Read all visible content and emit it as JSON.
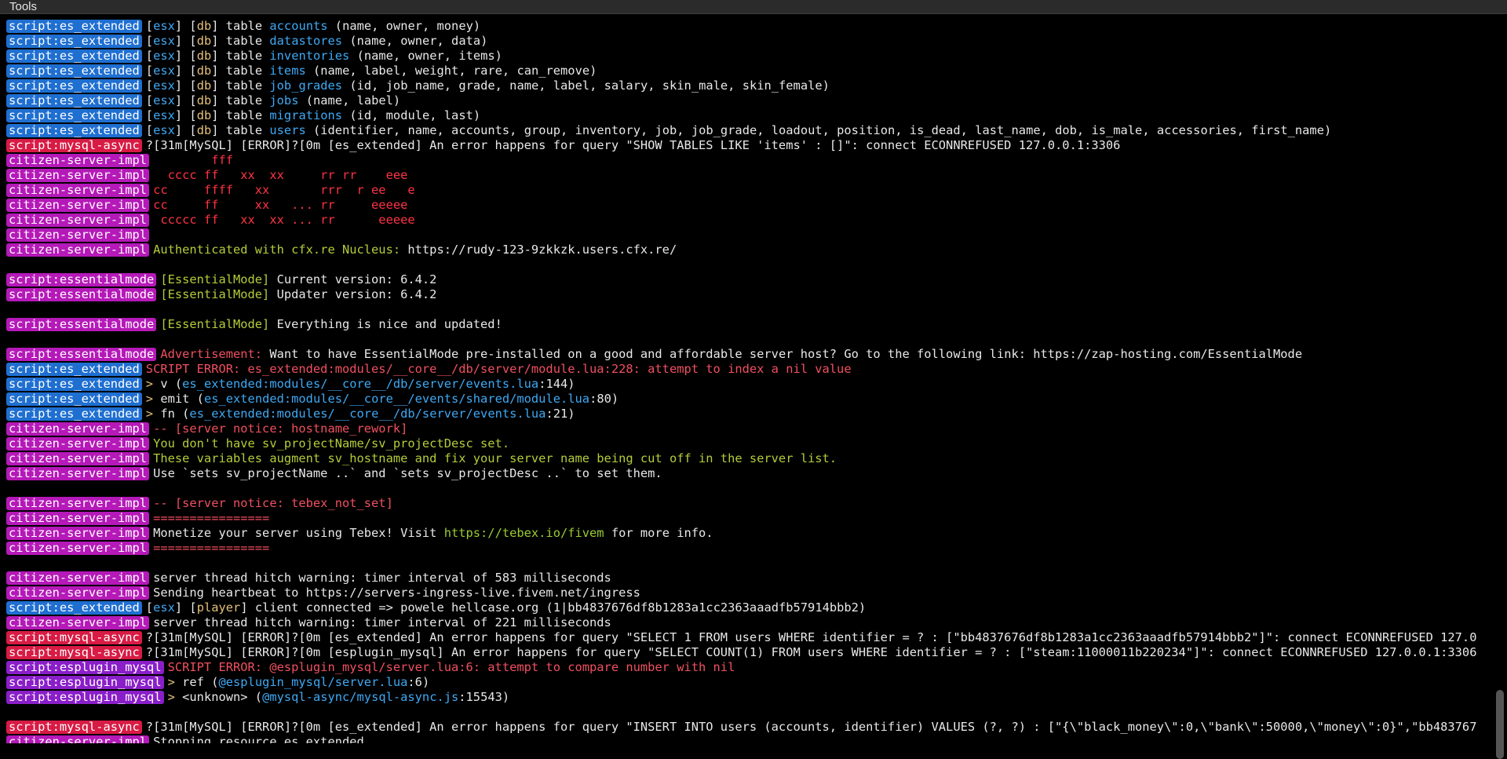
{
  "menu": {
    "tools": "Tools"
  },
  "colors": {
    "es_extended": "#1f6fd1",
    "mysql_async": "#d81b44",
    "citizen": "#b519b8",
    "essentialmode": "#b519b8",
    "esplugin_mysql": "#8a1ec9",
    "cyan": "#3fa9f5",
    "yellow": "#e5c07b",
    "red": "#f05060",
    "green": "#b5cc3a"
  },
  "lines": [
    {
      "tag": "script:es_extended",
      "tagColor": "#1f6fd1",
      "segs": [
        {
          "t": "[",
          "c": "white"
        },
        {
          "t": "esx",
          "c": "cyan"
        },
        {
          "t": "] [",
          "c": "white"
        },
        {
          "t": "db",
          "c": "yellow"
        },
        {
          "t": "] table ",
          "c": "white"
        },
        {
          "t": "accounts",
          "c": "cyan"
        },
        {
          "t": " (name, owner, money)",
          "c": "white"
        }
      ]
    },
    {
      "tag": "script:es_extended",
      "tagColor": "#1f6fd1",
      "segs": [
        {
          "t": "[",
          "c": "white"
        },
        {
          "t": "esx",
          "c": "cyan"
        },
        {
          "t": "] [",
          "c": "white"
        },
        {
          "t": "db",
          "c": "yellow"
        },
        {
          "t": "] table ",
          "c": "white"
        },
        {
          "t": "datastores",
          "c": "cyan"
        },
        {
          "t": " (name, owner, data)",
          "c": "white"
        }
      ]
    },
    {
      "tag": "script:es_extended",
      "tagColor": "#1f6fd1",
      "segs": [
        {
          "t": "[",
          "c": "white"
        },
        {
          "t": "esx",
          "c": "cyan"
        },
        {
          "t": "] [",
          "c": "white"
        },
        {
          "t": "db",
          "c": "yellow"
        },
        {
          "t": "] table ",
          "c": "white"
        },
        {
          "t": "inventories",
          "c": "cyan"
        },
        {
          "t": " (name, owner, items)",
          "c": "white"
        }
      ]
    },
    {
      "tag": "script:es_extended",
      "tagColor": "#1f6fd1",
      "segs": [
        {
          "t": "[",
          "c": "white"
        },
        {
          "t": "esx",
          "c": "cyan"
        },
        {
          "t": "] [",
          "c": "white"
        },
        {
          "t": "db",
          "c": "yellow"
        },
        {
          "t": "] table ",
          "c": "white"
        },
        {
          "t": "items",
          "c": "cyan"
        },
        {
          "t": " (name, label, weight, rare, can_remove)",
          "c": "white"
        }
      ]
    },
    {
      "tag": "script:es_extended",
      "tagColor": "#1f6fd1",
      "segs": [
        {
          "t": "[",
          "c": "white"
        },
        {
          "t": "esx",
          "c": "cyan"
        },
        {
          "t": "] [",
          "c": "white"
        },
        {
          "t": "db",
          "c": "yellow"
        },
        {
          "t": "] table ",
          "c": "white"
        },
        {
          "t": "job_grades",
          "c": "cyan"
        },
        {
          "t": " (id, job_name, grade, name, label, salary, skin_male, skin_female)",
          "c": "white"
        }
      ]
    },
    {
      "tag": "script:es_extended",
      "tagColor": "#1f6fd1",
      "segs": [
        {
          "t": "[",
          "c": "white"
        },
        {
          "t": "esx",
          "c": "cyan"
        },
        {
          "t": "] [",
          "c": "white"
        },
        {
          "t": "db",
          "c": "yellow"
        },
        {
          "t": "] table ",
          "c": "white"
        },
        {
          "t": "jobs",
          "c": "cyan"
        },
        {
          "t": " (name, label)",
          "c": "white"
        }
      ]
    },
    {
      "tag": "script:es_extended",
      "tagColor": "#1f6fd1",
      "segs": [
        {
          "t": "[",
          "c": "white"
        },
        {
          "t": "esx",
          "c": "cyan"
        },
        {
          "t": "] [",
          "c": "white"
        },
        {
          "t": "db",
          "c": "yellow"
        },
        {
          "t": "] table ",
          "c": "white"
        },
        {
          "t": "migrations",
          "c": "cyan"
        },
        {
          "t": " (id, module, last)",
          "c": "white"
        }
      ]
    },
    {
      "tag": "script:es_extended",
      "tagColor": "#1f6fd1",
      "segs": [
        {
          "t": "[",
          "c": "white"
        },
        {
          "t": "esx",
          "c": "cyan"
        },
        {
          "t": "] [",
          "c": "white"
        },
        {
          "t": "db",
          "c": "yellow"
        },
        {
          "t": "] table ",
          "c": "white"
        },
        {
          "t": "users",
          "c": "cyan"
        },
        {
          "t": " (identifier, name, accounts, group, inventory, job, job_grade, loadout, position, is_dead, last_name, dob, is_male, accessories, first_name)",
          "c": "white"
        }
      ]
    },
    {
      "tag": "script:mysql-async",
      "tagColor": "#d81b44",
      "segs": [
        {
          "t": "?[31m[MySQL] [ERROR]?[0m [es_extended] An error happens for query \"SHOW TABLES LIKE 'items' : []\": connect ECONNREFUSED 127.0.0.1:3306",
          "c": "white"
        }
      ]
    },
    {
      "tag": "citizen-server-impl",
      "tagColor": "#b519b8",
      "segs": [
        {
          "t": "        fff",
          "c": "ascii"
        }
      ]
    },
    {
      "tag": "citizen-server-impl",
      "tagColor": "#b519b8",
      "segs": [
        {
          "t": "  cccc ff   xx  xx     rr rr    eee",
          "c": "ascii"
        }
      ]
    },
    {
      "tag": "citizen-server-impl",
      "tagColor": "#b519b8",
      "segs": [
        {
          "t": "cc     ffff   xx       rrr  r ee   e",
          "c": "ascii"
        }
      ]
    },
    {
      "tag": "citizen-server-impl",
      "tagColor": "#b519b8",
      "segs": [
        {
          "t": "cc     ff     xx   ... rr     eeeee",
          "c": "ascii"
        }
      ]
    },
    {
      "tag": "citizen-server-impl",
      "tagColor": "#b519b8",
      "segs": [
        {
          "t": " ccccc ff   xx  xx ... rr      eeeee",
          "c": "ascii"
        }
      ]
    },
    {
      "tag": "citizen-server-impl",
      "tagColor": "#b519b8",
      "segs": []
    },
    {
      "tag": "citizen-server-impl",
      "tagColor": "#b519b8",
      "segs": [
        {
          "t": "Authenticated with cfx.re Nucleus: ",
          "c": "green"
        },
        {
          "t": "https://rudy-123-9zkkzk.users.cfx.re/",
          "c": "white"
        }
      ]
    },
    {
      "blank": true
    },
    {
      "tag": "script:essentialmode",
      "tagColor": "#b519b8",
      "segs": [
        {
          "t": "[EssentialMode]",
          "c": "green"
        },
        {
          "t": " Current version: 6.4.2",
          "c": "white"
        }
      ]
    },
    {
      "tag": "script:essentialmode",
      "tagColor": "#b519b8",
      "segs": [
        {
          "t": "[EssentialMode]",
          "c": "green"
        },
        {
          "t": " Updater version: 6.4.2",
          "c": "white"
        }
      ]
    },
    {
      "blank": true
    },
    {
      "tag": "script:essentialmode",
      "tagColor": "#b519b8",
      "segs": [
        {
          "t": "[EssentialMode]",
          "c": "green"
        },
        {
          "t": " Everything is nice and updated!",
          "c": "white"
        }
      ]
    },
    {
      "blank": true
    },
    {
      "tag": "script:essentialmode",
      "tagColor": "#b519b8",
      "segs": [
        {
          "t": "Advertisement:",
          "c": "red"
        },
        {
          "t": " Want to have EssentialMode pre-installed on a good and affordable server host? Go to the following link: https://zap-hosting.com/EssentialMode",
          "c": "white"
        }
      ]
    },
    {
      "tag": "script:es_extended",
      "tagColor": "#1f6fd1",
      "segs": [
        {
          "t": "SCRIPT ERROR: es_extended:modules/__core__/db/server/module.lua:228: attempt to index a nil value",
          "c": "red"
        }
      ]
    },
    {
      "tag": "script:es_extended",
      "tagColor": "#1f6fd1",
      "segs": [
        {
          "t": "> ",
          "c": "yellow"
        },
        {
          "t": "v (",
          "c": "white"
        },
        {
          "t": "es_extended:modules/__core__/db/server/events.lua",
          "c": "cyan"
        },
        {
          "t": ":144)",
          "c": "white"
        }
      ]
    },
    {
      "tag": "script:es_extended",
      "tagColor": "#1f6fd1",
      "segs": [
        {
          "t": "> ",
          "c": "yellow"
        },
        {
          "t": "emit (",
          "c": "white"
        },
        {
          "t": "es_extended:modules/__core__/events/shared/module.lua",
          "c": "cyan"
        },
        {
          "t": ":80)",
          "c": "white"
        }
      ]
    },
    {
      "tag": "script:es_extended",
      "tagColor": "#1f6fd1",
      "segs": [
        {
          "t": "> ",
          "c": "yellow"
        },
        {
          "t": "fn (",
          "c": "white"
        },
        {
          "t": "es_extended:modules/__core__/db/server/events.lua",
          "c": "cyan"
        },
        {
          "t": ":21)",
          "c": "white"
        }
      ]
    },
    {
      "tag": "citizen-server-impl",
      "tagColor": "#b519b8",
      "segs": [
        {
          "t": "-- [server notice: hostname_rework]",
          "c": "red"
        }
      ]
    },
    {
      "tag": "citizen-server-impl",
      "tagColor": "#b519b8",
      "segs": [
        {
          "t": "You don't have sv_projectName/sv_projectDesc set.",
          "c": "green"
        }
      ]
    },
    {
      "tag": "citizen-server-impl",
      "tagColor": "#b519b8",
      "segs": [
        {
          "t": "These variables augment sv_hostname and fix your server name being cut off in the server list.",
          "c": "green"
        }
      ]
    },
    {
      "tag": "citizen-server-impl",
      "tagColor": "#b519b8",
      "segs": [
        {
          "t": "Use `sets sv_projectName ..` and `sets sv_projectDesc ..` to set them.",
          "c": "white"
        }
      ]
    },
    {
      "blank": true
    },
    {
      "tag": "citizen-server-impl",
      "tagColor": "#b519b8",
      "segs": [
        {
          "t": "-- [server notice: tebex_not_set]",
          "c": "red"
        }
      ]
    },
    {
      "tag": "citizen-server-impl",
      "tagColor": "#b519b8",
      "segs": [
        {
          "t": "================",
          "c": "red"
        }
      ]
    },
    {
      "tag": "citizen-server-impl",
      "tagColor": "#b519b8",
      "segs": [
        {
          "t": "Monetize your server using Tebex! Visit ",
          "c": "white"
        },
        {
          "t": "https://tebex.io/fivem",
          "c": "link"
        },
        {
          "t": " for more info.",
          "c": "white"
        }
      ]
    },
    {
      "tag": "citizen-server-impl",
      "tagColor": "#b519b8",
      "segs": [
        {
          "t": "================",
          "c": "red"
        }
      ]
    },
    {
      "blank": true
    },
    {
      "tag": "citizen-server-impl",
      "tagColor": "#b519b8",
      "segs": [
        {
          "t": "server thread hitch warning: timer interval of 583 milliseconds",
          "c": "white"
        }
      ]
    },
    {
      "tag": "citizen-server-impl",
      "tagColor": "#b519b8",
      "segs": [
        {
          "t": "Sending heartbeat to https://servers-ingress-live.fivem.net/ingress",
          "c": "white"
        }
      ]
    },
    {
      "tag": "script:es_extended",
      "tagColor": "#1f6fd1",
      "segs": [
        {
          "t": "[",
          "c": "white"
        },
        {
          "t": "esx",
          "c": "cyan"
        },
        {
          "t": "] [",
          "c": "white"
        },
        {
          "t": "player",
          "c": "yellow"
        },
        {
          "t": "] client connected => powele hellcase.org (1|bb4837676df8b1283a1cc2363aaadfb57914bbb2)",
          "c": "white"
        }
      ]
    },
    {
      "tag": "citizen-server-impl",
      "tagColor": "#b519b8",
      "segs": [
        {
          "t": "server thread hitch warning: timer interval of 221 milliseconds",
          "c": "white"
        }
      ]
    },
    {
      "tag": "script:mysql-async",
      "tagColor": "#d81b44",
      "segs": [
        {
          "t": "?[31m[MySQL] [ERROR]?[0m [es_extended] An error happens for query \"SELECT 1 FROM users WHERE identifier = ? : [\"bb4837676df8b1283a1cc2363aaadfb57914bbb2\"]\": connect ECONNREFUSED 127.0",
          "c": "white"
        }
      ]
    },
    {
      "tag": "script:mysql-async",
      "tagColor": "#d81b44",
      "segs": [
        {
          "t": "?[31m[MySQL] [ERROR]?[0m [esplugin_mysql] An error happens for query \"SELECT COUNT(1) FROM users WHERE identifier = ? : [\"steam:11000011b220234\"]\": connect ECONNREFUSED 127.0.0.1:3306",
          "c": "white"
        }
      ]
    },
    {
      "tag": "script:esplugin_mysql",
      "tagColor": "#8a1ec9",
      "segs": [
        {
          "t": "SCRIPT ERROR: @esplugin_mysql/server.lua:6: attempt to compare number with nil",
          "c": "red"
        }
      ]
    },
    {
      "tag": "script:esplugin_mysql",
      "tagColor": "#8a1ec9",
      "segs": [
        {
          "t": "> ",
          "c": "yellow"
        },
        {
          "t": "ref (",
          "c": "white"
        },
        {
          "t": "@esplugin_mysql/server.lua",
          "c": "cyan"
        },
        {
          "t": ":6)",
          "c": "white"
        }
      ]
    },
    {
      "tag": "script:esplugin_mysql",
      "tagColor": "#8a1ec9",
      "segs": [
        {
          "t": "> ",
          "c": "yellow"
        },
        {
          "t": "<unknown> (",
          "c": "white"
        },
        {
          "t": "@mysql-async/mysql-async.js",
          "c": "cyan"
        },
        {
          "t": ":15543)",
          "c": "white"
        }
      ]
    },
    {
      "blank": true
    },
    {
      "tag": "script:mysql-async",
      "tagColor": "#d81b44",
      "segs": [
        {
          "t": "?[31m[MySQL] [ERROR]?[0m [es_extended] An error happens for query \"INSERT INTO users (accounts, identifier) VALUES (?, ?) : [\"{\\\"black_money\\\":0,\\\"bank\\\":50000,\\\"money\\\":0}\",\"bb483767",
          "c": "white"
        }
      ]
    },
    {
      "tag": "citizen-server-impl",
      "tagColor": "#b519b8",
      "segs": [
        {
          "t": "Stopping resource es_extended",
          "c": "white"
        }
      ]
    }
  ]
}
